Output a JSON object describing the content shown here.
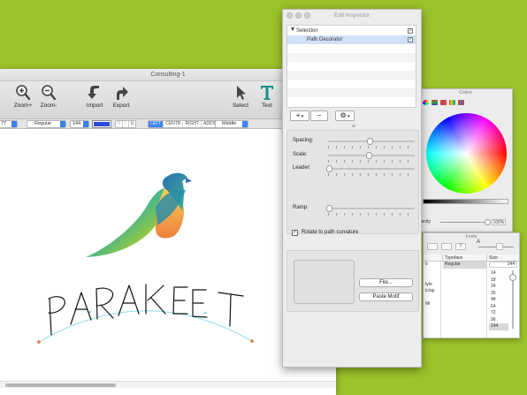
{
  "main_window": {
    "title": "Consulting-1",
    "tools": [
      {
        "icon": "zoom-in-icon",
        "label": "Zoom+"
      },
      {
        "icon": "zoom-out-icon",
        "label": "Zoom-"
      },
      {
        "icon": "import-icon",
        "label": "Import"
      },
      {
        "icon": "export-icon",
        "label": "Export"
      },
      {
        "icon": "select-arrow-icon",
        "label": "Select"
      },
      {
        "icon": "text-tool-icon",
        "label": "Text"
      }
    ],
    "format_bar": {
      "font_size_partial": "77",
      "style": "Regular",
      "size": "144",
      "stroke_color": "#2a4bd8",
      "text_style_letters": [
        "B",
        "I",
        "U"
      ],
      "alignment": [
        "LEFT",
        "CENTR",
        "RIGHT",
        "ADDS"
      ],
      "alignment_selected": "LEFT",
      "vertical": "Middle"
    },
    "artwork": {
      "word": "PARAKEET",
      "path_color": "#7fd6e8",
      "node_color": "#e8743a",
      "bird_colors": [
        "#2a9d8f",
        "#f4a261",
        "#9bc53d"
      ]
    }
  },
  "colors_panel": {
    "title": "Colors",
    "opacity_label": "Opacity",
    "opacity_value": "100%"
  },
  "fonts_panel": {
    "title": "Fonts",
    "toolbar_glyphs": [
      "T",
      "A"
    ],
    "col_typeface": "Typeface",
    "col_size": "Size",
    "typeface_items": [
      "Regular"
    ],
    "family_partials": [
      "b",
      "",
      "",
      "tyle",
      "ic/ap",
      "",
      "Mi",
      "",
      ""
    ],
    "size_value": "144",
    "sizes": [
      "14",
      "18",
      "24",
      "36",
      "48",
      "64",
      "72",
      "96",
      "144"
    ]
  },
  "inspector": {
    "title": "Edit Inspector",
    "list_items": [
      {
        "label": "Selection",
        "checked": true,
        "expandable": true
      },
      {
        "label": "Path Decorator",
        "checked": true,
        "expandable": false
      }
    ],
    "add_button": "+",
    "remove_button": "−",
    "gear_button": "⚙",
    "controls": {
      "spacing_label": "Spacing:",
      "spacing_value": 0.5,
      "scale_label": "Scale:",
      "scale_value": 0.49,
      "leader_label": "Leader:",
      "leader_value": 0.0,
      "ramp_label": "Ramp:",
      "ramp_value": 0.0
    },
    "rotate_label": "Rotate to path curvature",
    "rotate_checked": true,
    "file_button": "File...",
    "paste_button": "Paste Motif"
  }
}
